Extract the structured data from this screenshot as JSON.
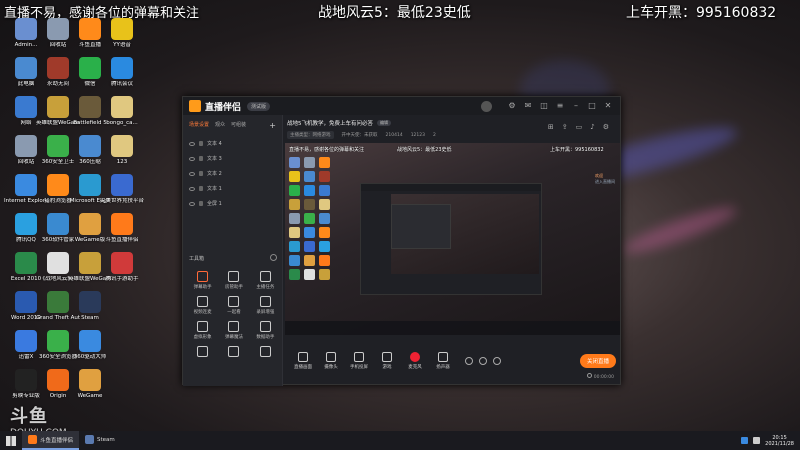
{
  "overlay": {
    "left_text": "直播不易，感谢各位的弹幕和关注",
    "center_text": "战地风云5：最低23史低",
    "right_text": "上车开黑：995160832"
  },
  "desktop_icons": [
    {
      "label": "Admin...",
      "color": "#6a8fd0"
    },
    {
      "label": "回收站",
      "color": "#8a9ab0"
    },
    {
      "label": "斗鱼直播",
      "color": "#ff8a1a"
    },
    {
      "label": "YY语音",
      "color": "#e8c21a"
    },
    {
      "label": "此电脑",
      "color": "#4a8ad0"
    },
    {
      "label": "永劫无间",
      "color": "#a03a2a"
    },
    {
      "label": "微信",
      "color": "#2ab04a"
    },
    {
      "label": "腾讯会议",
      "color": "#2a8ae0"
    },
    {
      "label": "网络",
      "color": "#3a7ad0"
    },
    {
      "label": "英雄联盟WeGame版",
      "color": "#c8a03a"
    },
    {
      "label": "Battlefield 5",
      "color": "#6a5a3a"
    },
    {
      "label": "bongo_ca...",
      "color": "#e0c880"
    },
    {
      "label": "回收站",
      "color": "#8a9ab0"
    },
    {
      "label": "360安全卫士",
      "color": "#3ab04a"
    },
    {
      "label": "360压缩",
      "color": "#4a8ad0"
    },
    {
      "label": "123",
      "color": "#e0c880"
    },
    {
      "label": "Internet Explorer",
      "color": "#3a8ae0"
    },
    {
      "label": "猎豹浏览器",
      "color": "#ff8a1a"
    },
    {
      "label": "Microsoft Edge",
      "color": "#2a9ad0"
    },
    {
      "label": "完美世界竞技平台",
      "color": "#3a6ad0"
    },
    {
      "label": "腾讯QQ",
      "color": "#2aa0e0"
    },
    {
      "label": "360软件管家",
      "color": "#3a8ad0"
    },
    {
      "label": "WeGame版",
      "color": "#e0a040"
    },
    {
      "label": "斗鱼直播伴侣",
      "color": "#ff7a1a"
    },
    {
      "label": "Excel 2010",
      "color": "#2a8a4a"
    },
    {
      "label": "《战地风云5》",
      "color": "#e0e0e0"
    },
    {
      "label": "英雄联盟WeGame版",
      "color": "#c8a03a"
    },
    {
      "label": "腾讯手游助手",
      "color": "#d03a3a"
    },
    {
      "label": "Word 2010",
      "color": "#2a5ab0"
    },
    {
      "label": "Grand Theft Auto V",
      "color": "#3a7a3a"
    },
    {
      "label": "Steam",
      "color": "#2a3a5a"
    },
    {
      "label": "",
      "color": "transparent"
    },
    {
      "label": "迅雷X",
      "color": "#3a7ae0"
    },
    {
      "label": "360安全浏览器",
      "color": "#3ab04a"
    },
    {
      "label": "360驱动大师",
      "color": "#3a8ae0"
    },
    {
      "label": "",
      "color": "transparent"
    },
    {
      "label": "剪映专业版",
      "color": "#222"
    },
    {
      "label": "Origin",
      "color": "#f06a1a"
    },
    {
      "label": "WeGame",
      "color": "#e0a040"
    }
  ],
  "watermark": {
    "logo": "斗鱼",
    "sub": "DOUYU.COM"
  },
  "app": {
    "name": "直播伴侣",
    "version": "测试版",
    "source_tabs": [
      "场景设置",
      "观众",
      "可组装"
    ],
    "plus": "+",
    "sources": [
      {
        "name": "文本 4"
      },
      {
        "name": "文本 3"
      },
      {
        "name": "文本 2"
      },
      {
        "name": "文本 1"
      },
      {
        "name": "全屏 1"
      }
    ],
    "tools_title": "工具箱",
    "tools": [
      {
        "label": "弹幕助手",
        "hot": true
      },
      {
        "label": "房管助手",
        "hot": false
      },
      {
        "label": "主播任务",
        "hot": false
      },
      {
        "label": "视频连麦",
        "hot": false
      },
      {
        "label": "一起看",
        "hot": false
      },
      {
        "label": "录屏增强",
        "hot": false
      },
      {
        "label": "虚拟形象",
        "hot": false
      },
      {
        "label": "弹幕魔法",
        "hot": false
      },
      {
        "label": "数据助手",
        "hot": false
      },
      {
        "label": "",
        "hot": false
      },
      {
        "label": "",
        "hot": false
      },
      {
        "label": "",
        "hot": false
      }
    ],
    "room_title": "战地5飞机教学，免费上车有问必答",
    "room_tag": "编辑",
    "category": "主播类型：网络游戏",
    "stats": [
      "开中天使：未获取",
      "210414",
      "12123",
      "2"
    ],
    "preview": {
      "left": "直播不易，感谢各位的弹幕和关注",
      "center": "战地风云5：最低23史低",
      "right": "上车开黑：995160832",
      "chat_user": "欢迎",
      "chat_text": "进入直播间"
    },
    "bottom_buttons": [
      "直播画面",
      "摄像头",
      "手机投屏",
      "游戏",
      "麦克风",
      "扬声器"
    ],
    "go_live": "关闭直播",
    "status": [
      "00:00:00"
    ]
  },
  "taskbar": {
    "tasks": [
      {
        "label": "斗鱼直播伴侣",
        "color": "#ff7a1a",
        "active": true
      },
      {
        "label": "Steam",
        "color": "#5a7ab0",
        "active": false
      }
    ],
    "time": "20:15",
    "date": "2021/11/28"
  }
}
